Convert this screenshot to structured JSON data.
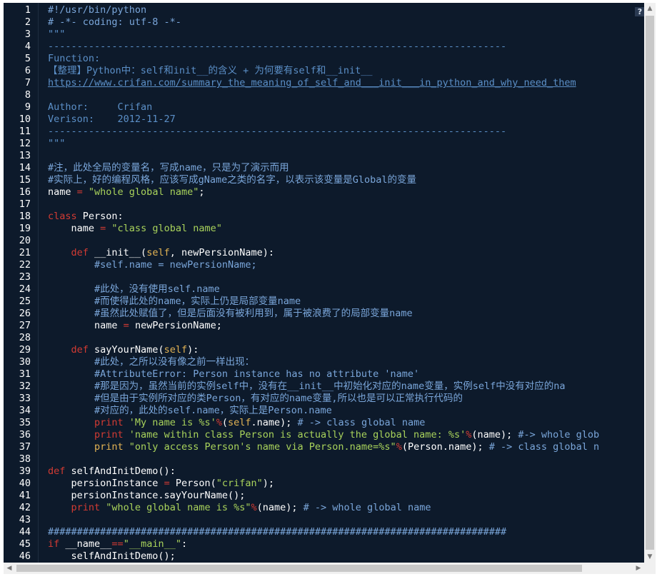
{
  "editor": {
    "help_icon_label": "?",
    "lines": [
      {
        "n": "1",
        "tokens": [
          {
            "t": "#!/usr/bin/python",
            "c": "c-com"
          }
        ]
      },
      {
        "n": "2",
        "tokens": [
          {
            "t": "# -*- coding: utf-8 -*-",
            "c": "c-com"
          }
        ]
      },
      {
        "n": "3",
        "tokens": [
          {
            "t": "\"\"\"",
            "c": "c-doc"
          }
        ]
      },
      {
        "n": "4",
        "tokens": [
          {
            "t": "-------------------------------------------------------------------------------",
            "c": "c-doc"
          }
        ]
      },
      {
        "n": "5",
        "tokens": [
          {
            "t": "Function:",
            "c": "c-doc"
          }
        ]
      },
      {
        "n": "6",
        "tokens": [
          {
            "t": "【整理】Python中：self和init__的含义 + 为何要有self和__init__",
            "c": "c-doc"
          }
        ]
      },
      {
        "n": "7",
        "tokens": [
          {
            "t": "https://www.crifan.com/summary_the_meaning_of_self_and___init___in_python_and_why_need_them",
            "c": "c-link"
          }
        ]
      },
      {
        "n": "8",
        "tokens": [
          {
            "t": "",
            "c": "c-txt"
          }
        ]
      },
      {
        "n": "9",
        "tokens": [
          {
            "t": "Author:     Crifan",
            "c": "c-doc"
          }
        ]
      },
      {
        "n": "10",
        "tokens": [
          {
            "t": "Verison:    2012-11-27",
            "c": "c-doc"
          }
        ]
      },
      {
        "n": "11",
        "tokens": [
          {
            "t": "-------------------------------------------------------------------------------",
            "c": "c-doc"
          }
        ]
      },
      {
        "n": "12",
        "tokens": [
          {
            "t": "\"\"\"",
            "c": "c-doc"
          }
        ]
      },
      {
        "n": "13",
        "tokens": [
          {
            "t": "",
            "c": "c-txt"
          }
        ]
      },
      {
        "n": "14",
        "tokens": [
          {
            "t": "#注，此处全局的变量名，写成name，只是为了演示而用",
            "c": "c-com"
          }
        ]
      },
      {
        "n": "15",
        "tokens": [
          {
            "t": "#实际上，好的编程风格，应该写成gName之类的名字，以表示该变量是Global的变量",
            "c": "c-com"
          }
        ]
      },
      {
        "n": "16",
        "tokens": [
          {
            "t": "name ",
            "c": "c-txt"
          },
          {
            "t": "=",
            "c": "c-kw"
          },
          {
            "t": " \"whole global name\"",
            "c": "c-str"
          },
          {
            "t": ";",
            "c": "c-txt"
          }
        ]
      },
      {
        "n": "17",
        "tokens": [
          {
            "t": "",
            "c": "c-txt"
          }
        ]
      },
      {
        "n": "18",
        "tokens": [
          {
            "t": "class",
            "c": "c-kw"
          },
          {
            "t": " Person:",
            "c": "c-txt"
          }
        ]
      },
      {
        "n": "19",
        "tokens": [
          {
            "t": "    name ",
            "c": "c-txt"
          },
          {
            "t": "=",
            "c": "c-kw"
          },
          {
            "t": " \"class global name\"",
            "c": "c-str"
          }
        ]
      },
      {
        "n": "20",
        "tokens": [
          {
            "t": "",
            "c": "c-txt"
          }
        ]
      },
      {
        "n": "21",
        "tokens": [
          {
            "t": "    ",
            "c": "c-txt"
          },
          {
            "t": "def",
            "c": "c-kw"
          },
          {
            "t": " __init__(",
            "c": "c-txt"
          },
          {
            "t": "self",
            "c": "c-self"
          },
          {
            "t": ", newPersionName):",
            "c": "c-txt"
          }
        ]
      },
      {
        "n": "22",
        "tokens": [
          {
            "t": "        #self.name = newPersionName;",
            "c": "c-com"
          }
        ]
      },
      {
        "n": "23",
        "tokens": [
          {
            "t": "",
            "c": "c-txt"
          }
        ]
      },
      {
        "n": "24",
        "tokens": [
          {
            "t": "        #此处，没有使用self.name",
            "c": "c-com"
          }
        ]
      },
      {
        "n": "25",
        "tokens": [
          {
            "t": "        #而使得此处的name，实际上仍是局部变量name",
            "c": "c-com"
          }
        ]
      },
      {
        "n": "26",
        "tokens": [
          {
            "t": "        #虽然此处赋值了，但是后面没有被利用到，属于被浪费了的局部变量name",
            "c": "c-com"
          }
        ]
      },
      {
        "n": "27",
        "tokens": [
          {
            "t": "        name ",
            "c": "c-txt"
          },
          {
            "t": "=",
            "c": "c-kw"
          },
          {
            "t": " newPersionName;",
            "c": "c-txt"
          }
        ]
      },
      {
        "n": "28",
        "tokens": [
          {
            "t": "",
            "c": "c-txt"
          }
        ]
      },
      {
        "n": "29",
        "tokens": [
          {
            "t": "    ",
            "c": "c-txt"
          },
          {
            "t": "def",
            "c": "c-kw"
          },
          {
            "t": " sayYourName(",
            "c": "c-txt"
          },
          {
            "t": "self",
            "c": "c-self"
          },
          {
            "t": "):",
            "c": "c-txt"
          }
        ]
      },
      {
        "n": "30",
        "tokens": [
          {
            "t": "        #此处，之所以没有像之前一样出现：",
            "c": "c-com"
          }
        ]
      },
      {
        "n": "31",
        "tokens": [
          {
            "t": "        #AttributeError: Person instance has no attribute 'name'",
            "c": "c-com"
          }
        ]
      },
      {
        "n": "32",
        "tokens": [
          {
            "t": "        #那是因为，虽然当前的实例self中，没有在__init__中初始化对应的name变量，实例self中没有对应的na",
            "c": "c-com"
          }
        ]
      },
      {
        "n": "33",
        "tokens": [
          {
            "t": "        #但是由于实例所对应的类Person，有对应的name变量,所以也是可以正常执行代码的",
            "c": "c-com"
          }
        ]
      },
      {
        "n": "34",
        "tokens": [
          {
            "t": "        #对应的，此处的self.name，实际上是Person.name",
            "c": "c-com"
          }
        ]
      },
      {
        "n": "35",
        "tokens": [
          {
            "t": "        ",
            "c": "c-txt"
          },
          {
            "t": "print",
            "c": "c-kw"
          },
          {
            "t": " 'My name is %s'",
            "c": "c-str"
          },
          {
            "t": "%",
            "c": "c-kw"
          },
          {
            "t": "(",
            "c": "c-txt"
          },
          {
            "t": "self",
            "c": "c-self"
          },
          {
            "t": ".name); ",
            "c": "c-txt"
          },
          {
            "t": "# -> class global name",
            "c": "c-com"
          }
        ]
      },
      {
        "n": "36",
        "tokens": [
          {
            "t": "        ",
            "c": "c-txt"
          },
          {
            "t": "print",
            "c": "c-kw"
          },
          {
            "t": " 'name within class Person is actually the global name: %s'",
            "c": "c-str"
          },
          {
            "t": "%",
            "c": "c-kw"
          },
          {
            "t": "(name); ",
            "c": "c-txt"
          },
          {
            "t": "#-> whole glob",
            "c": "c-com"
          }
        ]
      },
      {
        "n": "37",
        "tokens": [
          {
            "t": "        ",
            "c": "c-txt"
          },
          {
            "t": "print",
            "c": "c-self"
          },
          {
            "t": " \"only access Person's name via Person.name=%s\"",
            "c": "c-str"
          },
          {
            "t": "%",
            "c": "c-kw"
          },
          {
            "t": "(Person.name); ",
            "c": "c-txt"
          },
          {
            "t": "# -> class global n",
            "c": "c-com"
          }
        ]
      },
      {
        "n": "38",
        "tokens": [
          {
            "t": "",
            "c": "c-txt"
          }
        ]
      },
      {
        "n": "39",
        "tokens": [
          {
            "t": "def",
            "c": "c-kw"
          },
          {
            "t": " selfAndInitDemo():",
            "c": "c-txt"
          }
        ]
      },
      {
        "n": "40",
        "tokens": [
          {
            "t": "    persionInstance ",
            "c": "c-txt"
          },
          {
            "t": "=",
            "c": "c-kw"
          },
          {
            "t": " Person(",
            "c": "c-txt"
          },
          {
            "t": "\"crifan\"",
            "c": "c-str"
          },
          {
            "t": ");",
            "c": "c-txt"
          }
        ]
      },
      {
        "n": "41",
        "tokens": [
          {
            "t": "    persionInstance.sayYourName();",
            "c": "c-txt"
          }
        ]
      },
      {
        "n": "42",
        "tokens": [
          {
            "t": "    ",
            "c": "c-txt"
          },
          {
            "t": "print",
            "c": "c-kw"
          },
          {
            "t": " \"whole global name is %s\"",
            "c": "c-str"
          },
          {
            "t": "%",
            "c": "c-kw"
          },
          {
            "t": "(name); ",
            "c": "c-txt"
          },
          {
            "t": "# -> whole global name",
            "c": "c-com"
          }
        ]
      },
      {
        "n": "43",
        "tokens": [
          {
            "t": "",
            "c": "c-txt"
          }
        ]
      },
      {
        "n": "44",
        "tokens": [
          {
            "t": "###############################################################################",
            "c": "c-com"
          }
        ]
      },
      {
        "n": "45",
        "tokens": [
          {
            "t": "if",
            "c": "c-kw"
          },
          {
            "t": " __name__",
            "c": "c-txt"
          },
          {
            "t": "==",
            "c": "c-kw"
          },
          {
            "t": "\"__main__\"",
            "c": "c-str"
          },
          {
            "t": ":",
            "c": "c-txt"
          }
        ]
      },
      {
        "n": "46",
        "tokens": [
          {
            "t": "    selfAndInitDemo();",
            "c": "c-txt"
          }
        ]
      }
    ]
  },
  "scrollbars": {
    "up_arrow": "▲",
    "down_arrow": "▼",
    "left_arrow": "◀",
    "right_arrow": "▶"
  }
}
